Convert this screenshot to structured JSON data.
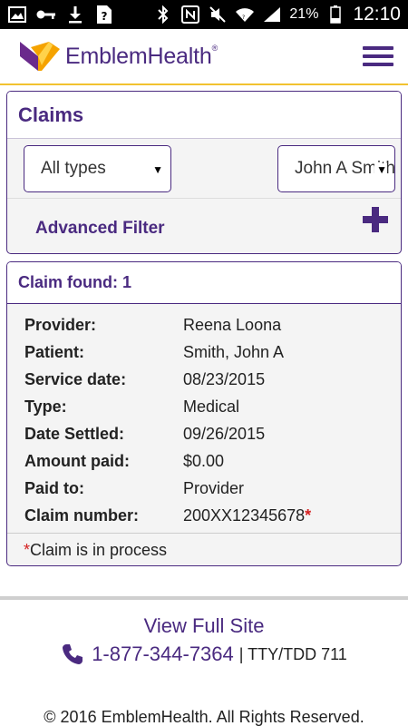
{
  "status_bar": {
    "battery": "21%",
    "time": "12:10",
    "left_icons": [
      "image-icon",
      "key-icon",
      "download-icon",
      "unknown-app-icon"
    ],
    "right_icons": [
      "bluetooth-icon",
      "nfc-icon",
      "mute-icon",
      "wifi-icon",
      "signal-icon",
      "battery-icon"
    ]
  },
  "header": {
    "brand": "EmblemHealth",
    "brand_mark": "®",
    "menu_icon": "hamburger-icon"
  },
  "claims": {
    "title": "Claims",
    "type_filter": "All types",
    "person_filter": "John A Smith",
    "advanced_filter": "Advanced Filter",
    "expand_icon": "plus-icon"
  },
  "result": {
    "count_label": "Claim found: 1",
    "rows": [
      {
        "label": "Provider:",
        "value": "Reena Loona"
      },
      {
        "label": "Patient:",
        "value": "Smith, John A"
      },
      {
        "label": "Service date:",
        "value": "08/23/2015"
      },
      {
        "label": "Type:",
        "value": "Medical"
      },
      {
        "label": "Date Settled:",
        "value": "09/26/2015"
      },
      {
        "label": "Amount paid:",
        "value": "$0.00"
      },
      {
        "label": "Paid to:",
        "value": "Provider"
      },
      {
        "label": "Claim number:",
        "value": "200XX12345678"
      }
    ],
    "asterisk": "*",
    "note": "Claim is in process"
  },
  "footer": {
    "view_full_site": "View Full Site",
    "phone": "1-877-344-7364",
    "tty": "| TTY/TDD 711",
    "copyright": "© 2016 EmblemHealth. All Rights Reserved."
  },
  "colors": {
    "brand_purple": "#4a2a80",
    "accent_yellow": "#f2c230",
    "required_red": "#d42020"
  }
}
